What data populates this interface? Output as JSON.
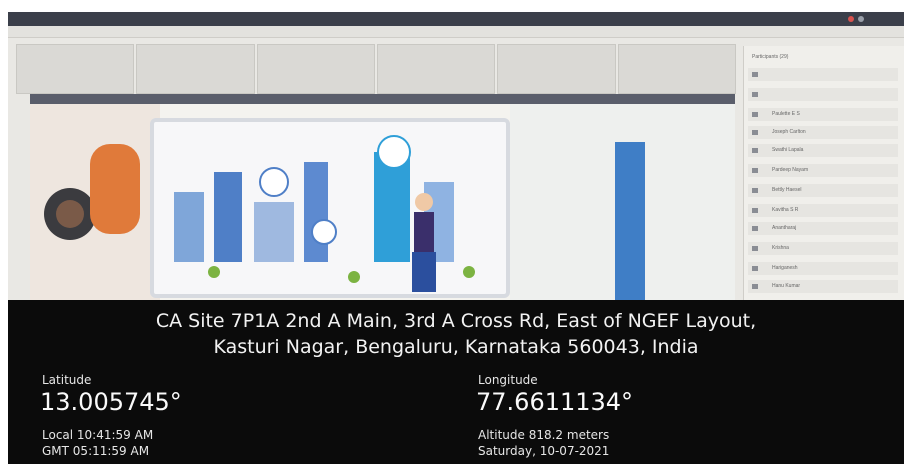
{
  "screen": {
    "participants_header": "Participants (29)",
    "participants": [
      "",
      "",
      "Paulette E S",
      "Joseph Carlton",
      "Swathi Lapala",
      "Pardeep Nayam",
      "Bettly Haesel",
      "Kavitha S R",
      "Anantharaj",
      "Krishna",
      "Hariganesh",
      "Hanu Kumar"
    ]
  },
  "geotag": {
    "address_line1": "CA Site 7P1A 2nd A Main, 3rd A Cross Rd, East of NGEF Layout,",
    "address_line2": "Kasturi Nagar, Bengaluru, Karnataka 560043, India",
    "latitude_label": "Latitude",
    "latitude_value": "13.005745°",
    "longitude_label": "Longitude",
    "longitude_value": "77.6611134°",
    "local_time": "Local 10:41:59 AM",
    "gmt_time": "GMT 05:11:59 AM",
    "altitude": "Altitude 818.2 meters",
    "date": "Saturday, 10-07-2021"
  },
  "colors": {
    "overlay_bg": "#0b0b0b",
    "accent_blue": "#3f7ec6",
    "device_frame": "#d7dae0"
  }
}
